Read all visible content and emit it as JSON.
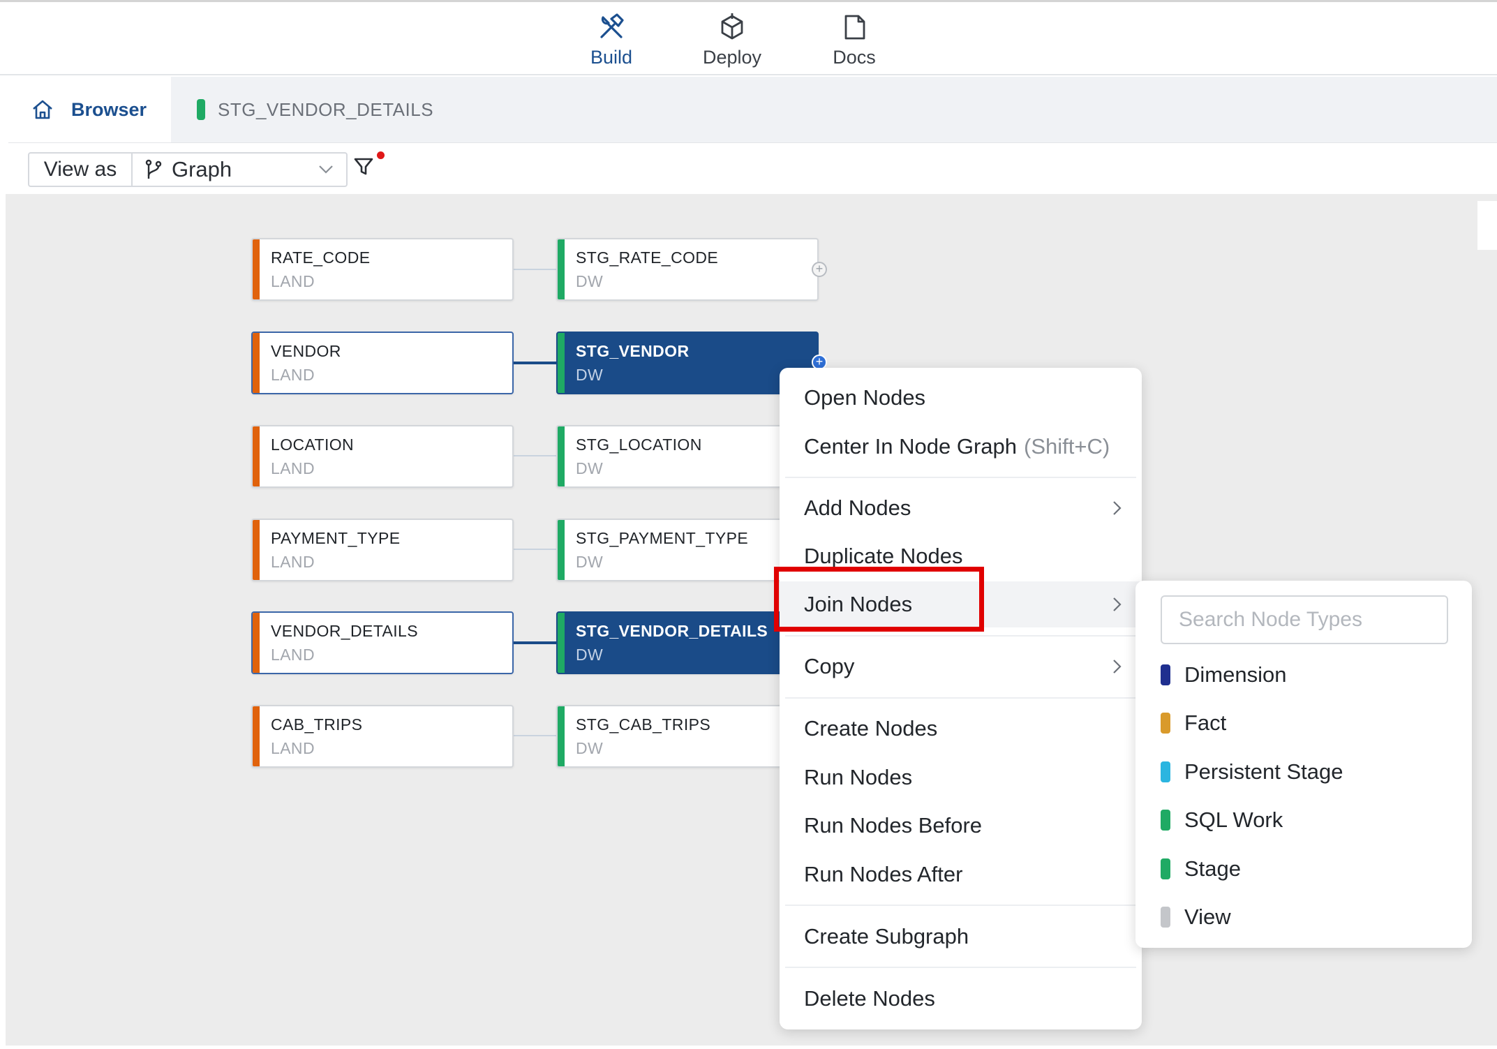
{
  "nav": {
    "build": "Build",
    "deploy": "Deploy",
    "docs": "Docs"
  },
  "tabs": {
    "browser": "Browser",
    "open_node": "STG_VENDOR_DETAILS"
  },
  "toolbar": {
    "view_as": "View as",
    "view_mode": "Graph"
  },
  "nodes": [
    {
      "name": "RATE_CODE",
      "type": "LAND"
    },
    {
      "name": "STG_RATE_CODE",
      "type": "DW"
    },
    {
      "name": "VENDOR",
      "type": "LAND"
    },
    {
      "name": "STG_VENDOR",
      "type": "DW"
    },
    {
      "name": "LOCATION",
      "type": "LAND"
    },
    {
      "name": "STG_LOCATION",
      "type": "DW"
    },
    {
      "name": "PAYMENT_TYPE",
      "type": "LAND"
    },
    {
      "name": "STG_PAYMENT_TYPE",
      "type": "DW"
    },
    {
      "name": "VENDOR_DETAILS",
      "type": "LAND"
    },
    {
      "name": "STG_VENDOR_DETAILS",
      "type": "DW"
    },
    {
      "name": "CAB_TRIPS",
      "type": "LAND"
    },
    {
      "name": "STG_CAB_TRIPS",
      "type": "DW"
    }
  ],
  "context_menu": {
    "open_nodes": "Open Nodes",
    "center": "Center In Node Graph",
    "center_shortcut": "(Shift+C)",
    "add_nodes": "Add Nodes",
    "duplicate_nodes": "Duplicate Nodes",
    "join_nodes": "Join Nodes",
    "copy": "Copy",
    "create_nodes": "Create Nodes",
    "run_nodes": "Run Nodes",
    "run_nodes_before": "Run Nodes Before",
    "run_nodes_after": "Run Nodes After",
    "create_subgraph": "Create Subgraph",
    "delete_nodes": "Delete Nodes"
  },
  "submenu": {
    "search_placeholder": "Search Node Types",
    "items": [
      {
        "label": "Dimension",
        "color": "#1f2f8f"
      },
      {
        "label": "Fact",
        "color": "#d99a2b"
      },
      {
        "label": "Persistent Stage",
        "color": "#2bb5e0"
      },
      {
        "label": "SQL Work",
        "color": "#1faa64"
      },
      {
        "label": "Stage",
        "color": "#1faa64"
      },
      {
        "label": "View",
        "color": "#c4c6ca"
      }
    ]
  },
  "colors": {
    "accent": "#1b4f8f",
    "selected_node": "#1a4b88",
    "land_bar": "#e0620c",
    "dw_bar": "#1faa64",
    "highlight_box": "#e00000"
  }
}
